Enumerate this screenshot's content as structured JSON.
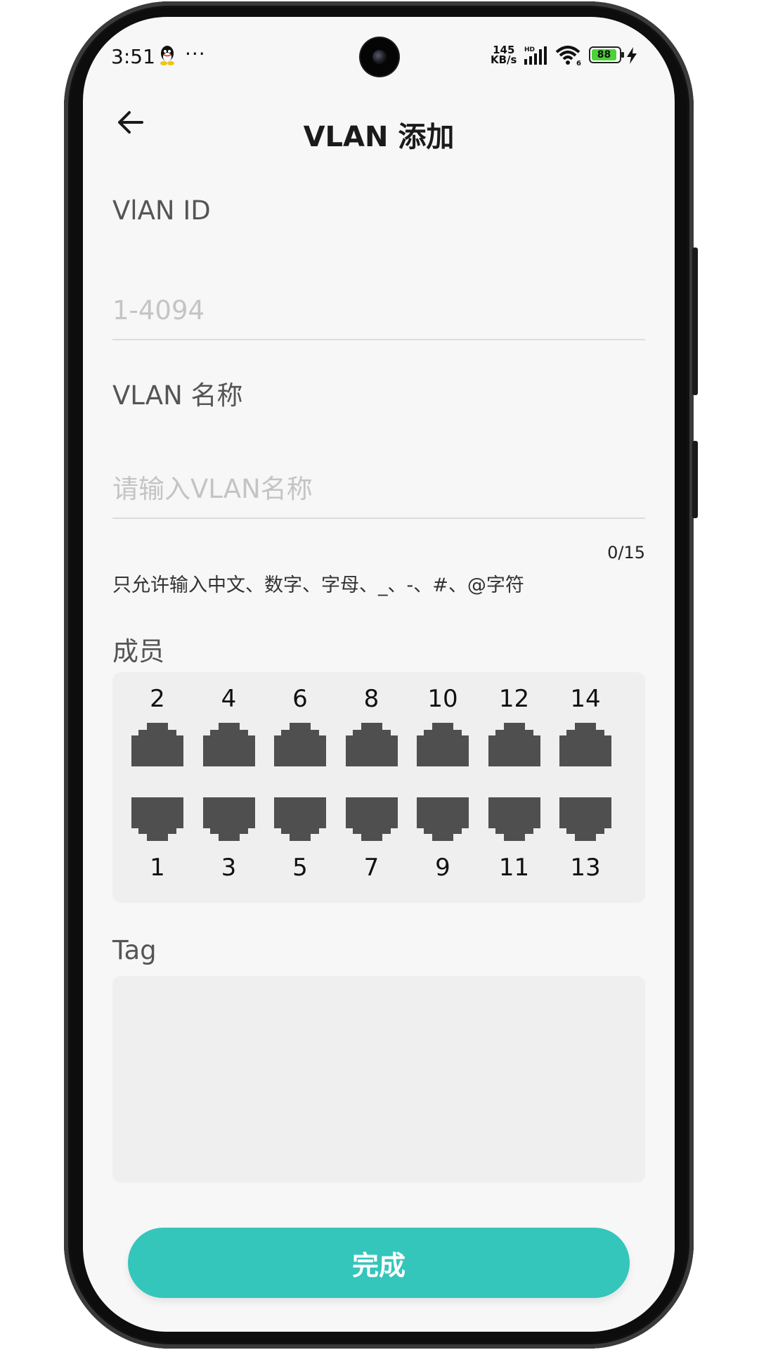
{
  "status_bar": {
    "time": "3:51",
    "more": "···",
    "net_speed_value": "145",
    "net_speed_unit": "KB/s",
    "battery": "88",
    "wifi_label": "6",
    "hd_label": "HD"
  },
  "header": {
    "title": "VLAN 添加",
    "back_icon": "arrow-left-icon"
  },
  "form": {
    "vlan_id": {
      "label": "VlAN ID",
      "value": "",
      "placeholder": "1-4094"
    },
    "vlan_name": {
      "label": "VLAN 名称",
      "value": "",
      "placeholder": "请输入VLAN名称",
      "counter": "0/15",
      "hint": "只允许输入中文、数字、字母、_、-、#、@字符"
    },
    "members": {
      "label": "成员",
      "top_ports": [
        "2",
        "4",
        "6",
        "8",
        "10",
        "12",
        "14"
      ],
      "bottom_ports": [
        "1",
        "3",
        "5",
        "7",
        "9",
        "11",
        "13"
      ],
      "port_icon": "ethernet-port-icon"
    },
    "tag": {
      "label": "Tag"
    }
  },
  "actions": {
    "done_label": "完成"
  },
  "colors": {
    "accent": "#34c5bb",
    "port": "#4f4f4f",
    "panel": "#efefef",
    "background": "#f7f7f7"
  }
}
